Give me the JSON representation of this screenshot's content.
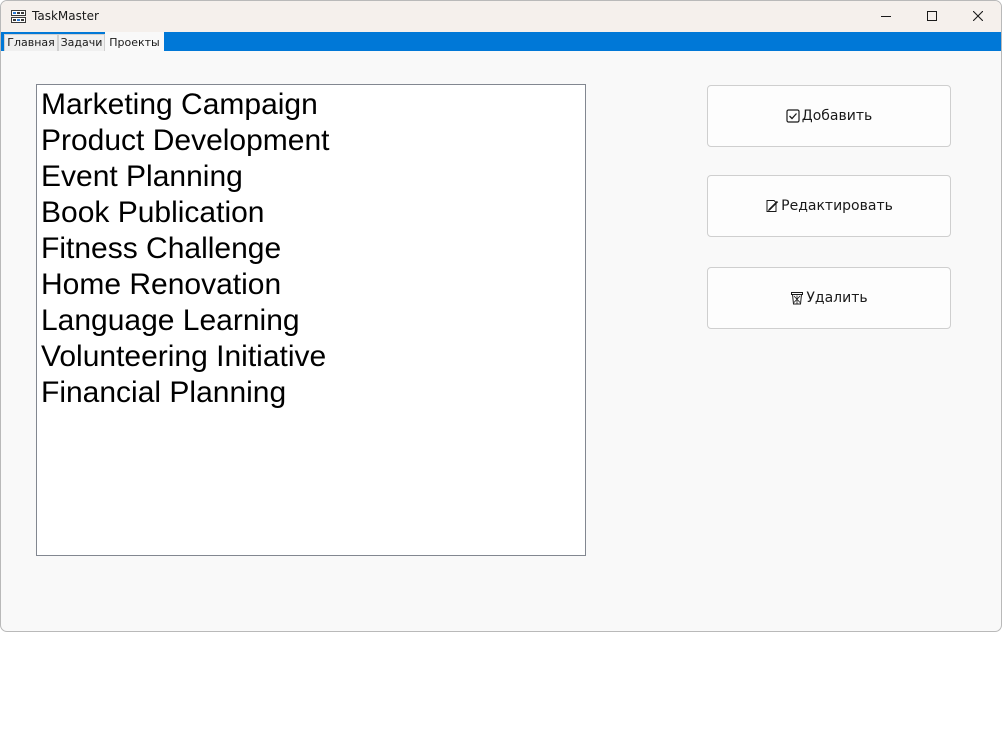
{
  "window": {
    "title": "TaskMaster",
    "app_icon": "app-grid-icon",
    "controls": [
      "minimize-icon",
      "maximize-icon",
      "close-icon"
    ]
  },
  "tabs": [
    {
      "label": "Главная",
      "active": false
    },
    {
      "label": "Задачи",
      "active": false
    },
    {
      "label": "Проекты",
      "active": true
    }
  ],
  "projects": {
    "items": [
      "Marketing Campaign",
      "Product Development",
      "Event Planning",
      "Book Publication",
      "Fitness Challenge",
      "Home Renovation",
      "Language Learning",
      "Volunteering Initiative",
      "Financial Planning"
    ]
  },
  "actions": {
    "add_label": "Добавить",
    "add_icon": "checkbox-icon",
    "edit_label": "Редактировать",
    "edit_icon": "edit-icon",
    "delete_label": "Удалить",
    "delete_icon": "trash-icon"
  },
  "colors": {
    "tab_strip": "#0078d7",
    "window_bg": "#f9f9f9",
    "titlebar_bg": "#f5f0ec"
  }
}
